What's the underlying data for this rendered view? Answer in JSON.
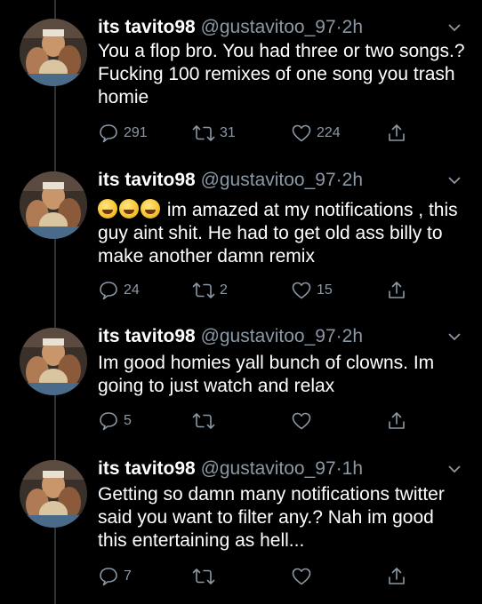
{
  "tweets": [
    {
      "name": "its tavito98",
      "handle": "@gustavitoo_97",
      "time": "2h",
      "text": "You a flop bro. You had three or two songs.? Fucking 100 remixes of one song you trash homie",
      "replies": "291",
      "retweets": "31",
      "likes": "224"
    },
    {
      "name": "its tavito98",
      "handle": "@gustavitoo_97",
      "time": "2h",
      "emoji": "rolling-on-the-floor-laughing",
      "text": "im amazed at my notifications , this guy aint shit. He had to get old ass billy to make another damn remix",
      "replies": "24",
      "retweets": "2",
      "likes": "15"
    },
    {
      "name": "its tavito98",
      "handle": "@gustavitoo_97",
      "time": "2h",
      "text": "Im good homies yall bunch of clowns. Im going to just watch and relax",
      "replies": "5",
      "retweets": "",
      "likes": ""
    },
    {
      "name": "its tavito98",
      "handle": "@gustavitoo_97",
      "time": "1h",
      "text": "Getting so damn many notifications twitter said you want to filter any.? Nah im good this entertaining as hell...",
      "replies": "7",
      "retweets": "",
      "likes": ""
    }
  ],
  "separator": "·",
  "colors": {
    "background": "#000000",
    "text": "#ffffff",
    "muted": "#8b98a5",
    "thread_line": "#2f3336"
  },
  "icons": [
    "reply-icon",
    "retweet-icon",
    "like-icon",
    "share-icon",
    "caret-down-icon",
    "laughing-emoji-icon"
  ]
}
